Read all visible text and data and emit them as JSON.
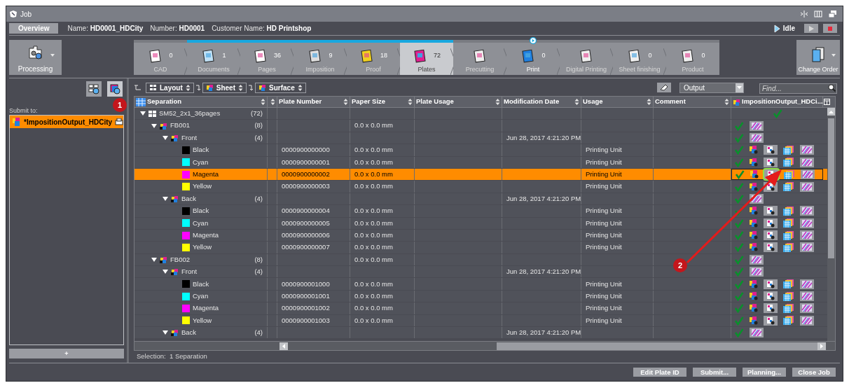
{
  "window": {
    "title": "Job"
  },
  "info": {
    "tab": "Overview",
    "fields": [
      {
        "label": "Name:",
        "value": "HD0001_HDCity"
      },
      {
        "label": "Number:",
        "value": "HD0001"
      },
      {
        "label": "Customer Name:",
        "value": "HD Printshop"
      }
    ],
    "status": "Idle"
  },
  "processing_button": "Processing",
  "change_order_button": "Change Order",
  "workflow_steps": [
    {
      "label": "CAD",
      "count": "0",
      "selected": false,
      "in_progress": false,
      "running": false
    },
    {
      "label": "Documents",
      "count": "1",
      "selected": false,
      "in_progress": true,
      "running": false
    },
    {
      "label": "Pages",
      "count": "36",
      "selected": false,
      "in_progress": true,
      "running": false
    },
    {
      "label": "Imposition",
      "count": "9",
      "selected": false,
      "in_progress": true,
      "running": false
    },
    {
      "label": "Proof",
      "count": "18",
      "selected": false,
      "in_progress": true,
      "running": false
    },
    {
      "label": "Plates",
      "count": "72",
      "selected": true,
      "in_progress": true,
      "running": false
    },
    {
      "label": "Precutting",
      "selected": false,
      "in_progress": false,
      "running": false
    },
    {
      "label": "Print",
      "count": "0",
      "selected": false,
      "in_progress": false,
      "running": true
    },
    {
      "label": "Digital Printing",
      "selected": false,
      "in_progress": false,
      "running": false
    },
    {
      "label": "Sheet finishing",
      "count": "0",
      "selected": false,
      "in_progress": false,
      "running": false
    },
    {
      "label": "Product",
      "count": "0",
      "selected": false,
      "in_progress": false,
      "running": false
    }
  ],
  "left_panel": {
    "tool_buttons": [
      {
        "selected": false
      },
      {
        "selected": true
      }
    ],
    "submit_label": "Submit to:",
    "targets": [
      {
        "label": "*ImpositionOutput_HDCity",
        "selected": true
      }
    ],
    "add_button": "+"
  },
  "filters": [
    "Layout",
    "Sheet",
    "Surface"
  ],
  "output_select": "Output",
  "find": {
    "placeholder": "Find..."
  },
  "table": {
    "columns": [
      "Separation",
      "",
      "Plate Number",
      "Paper Size",
      "Plate Usage",
      "Modification Date",
      "Usage",
      "Comment",
      "ImpositionOutput_HDCi..."
    ],
    "rows": [
      {
        "kind": "job",
        "label": "SM52_2x1_36pages",
        "count": "(72)",
        "expanded": true,
        "selected": false,
        "children": [
          {
            "kind": "sheet",
            "label": "FB001",
            "count": "(8)",
            "paper_size": "0.0 x 0.0 mm",
            "expanded": true,
            "selected": false,
            "children": [
              {
                "kind": "side",
                "label": "Front",
                "count": "(4)",
                "date": "Jun 28, 2017 4:21:20 PM",
                "expanded": true,
                "selected": false,
                "children": [
                  {
                    "kind": "separation",
                    "label": "Black",
                    "color": "#000000",
                    "plate_number": "0000900000000",
                    "paper_size": "0.0 x 0.0 mm",
                    "usage": "Printing Unit",
                    "selected": false
                  },
                  {
                    "kind": "separation",
                    "label": "Cyan",
                    "color": "#00ffff",
                    "plate_number": "0000900000001",
                    "paper_size": "0.0 x 0.0 mm",
                    "usage": "Printing Unit",
                    "selected": false
                  },
                  {
                    "kind": "separation",
                    "label": "Magenta",
                    "color": "#ff00ff",
                    "plate_number": "0000900000002",
                    "paper_size": "0.0 x 0.0 mm",
                    "usage": "Printing Unit",
                    "selected": true
                  },
                  {
                    "kind": "separation",
                    "label": "Yellow",
                    "color": "#ffff00",
                    "plate_number": "0000900000003",
                    "paper_size": "0.0 x 0.0 mm",
                    "usage": "Printing Unit",
                    "selected": false
                  }
                ]
              },
              {
                "kind": "side",
                "label": "Back",
                "count": "(4)",
                "date": "Jun 28, 2017 4:21:20 PM",
                "expanded": true,
                "selected": false,
                "children": [
                  {
                    "kind": "separation",
                    "label": "Black",
                    "color": "#000000",
                    "plate_number": "0000900000004",
                    "paper_size": "0.0 x 0.0 mm",
                    "usage": "Printing Unit",
                    "selected": false
                  },
                  {
                    "kind": "separation",
                    "label": "Cyan",
                    "color": "#00ffff",
                    "plate_number": "0000900000005",
                    "paper_size": "0.0 x 0.0 mm",
                    "usage": "Printing Unit",
                    "selected": false
                  },
                  {
                    "kind": "separation",
                    "label": "Magenta",
                    "color": "#ff00ff",
                    "plate_number": "0000900000006",
                    "paper_size": "0.0 x 0.0 mm",
                    "usage": "Printing Unit",
                    "selected": false
                  },
                  {
                    "kind": "separation",
                    "label": "Yellow",
                    "color": "#ffff00",
                    "plate_number": "0000900000007",
                    "paper_size": "0.0 x 0.0 mm",
                    "usage": "Printing Unit",
                    "selected": false
                  }
                ]
              }
            ]
          },
          {
            "kind": "sheet",
            "label": "FB002",
            "count": "(8)",
            "paper_size": "0.0 x 0.0 mm",
            "expanded": true,
            "selected": false,
            "children": [
              {
                "kind": "side",
                "label": "Front",
                "count": "(4)",
                "date": "Jun 28, 2017 4:21:20 PM",
                "expanded": true,
                "selected": false,
                "children": [
                  {
                    "kind": "separation",
                    "label": "Black",
                    "color": "#000000",
                    "plate_number": "0000900001000",
                    "paper_size": "0.0 x 0.0 mm",
                    "usage": "Printing Unit",
                    "selected": false
                  },
                  {
                    "kind": "separation",
                    "label": "Cyan",
                    "color": "#00ffff",
                    "plate_number": "0000900001001",
                    "paper_size": "0.0 x 0.0 mm",
                    "usage": "Printing Unit",
                    "selected": false
                  },
                  {
                    "kind": "separation",
                    "label": "Magenta",
                    "color": "#ff00ff",
                    "plate_number": "0000900001002",
                    "paper_size": "0.0 x 0.0 mm",
                    "usage": "Printing Unit",
                    "selected": false
                  },
                  {
                    "kind": "separation",
                    "label": "Yellow",
                    "color": "#ffff00",
                    "plate_number": "0000900001003",
                    "paper_size": "0.0 x 0.0 mm",
                    "usage": "Printing Unit",
                    "selected": false
                  }
                ]
              },
              {
                "kind": "side",
                "label": "Back",
                "count": "(4)",
                "date": "Jun 28, 2017 4:21:20 PM",
                "expanded": true,
                "selected": false
              }
            ]
          }
        ]
      }
    ]
  },
  "selection_status": "Selection:  1 Separation",
  "buttons": [
    "Edit Plate ID",
    "Submit...",
    "Planning...",
    "Close Job"
  ],
  "annotations": [
    "1",
    "2"
  ]
}
